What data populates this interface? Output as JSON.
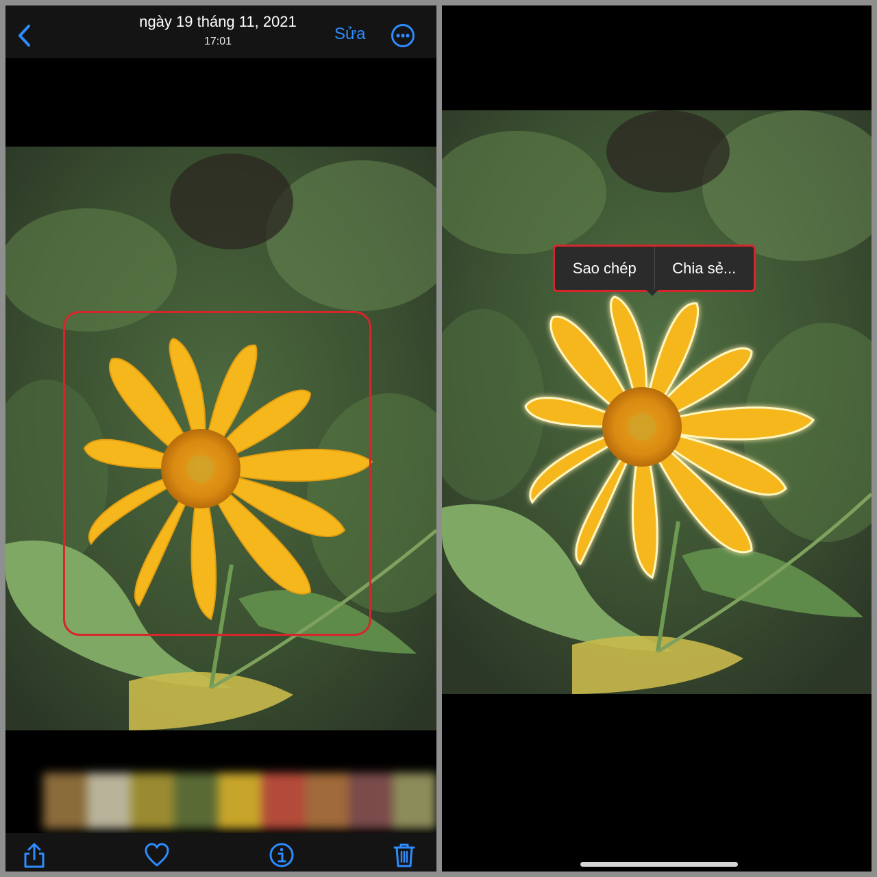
{
  "left_screen": {
    "header": {
      "title_date": "ngày 19 tháng 11, 2021",
      "title_time": "17:01",
      "edit_label": "Sửa"
    },
    "toolbar_icons": [
      "share-icon",
      "heart-icon",
      "info-icon",
      "trash-icon"
    ],
    "accent_color": "#2d8cff",
    "highlight_color": "#d7262b"
  },
  "right_screen": {
    "context_menu": {
      "copy_label": "Sao chép",
      "share_label": "Chia sẻ..."
    }
  }
}
